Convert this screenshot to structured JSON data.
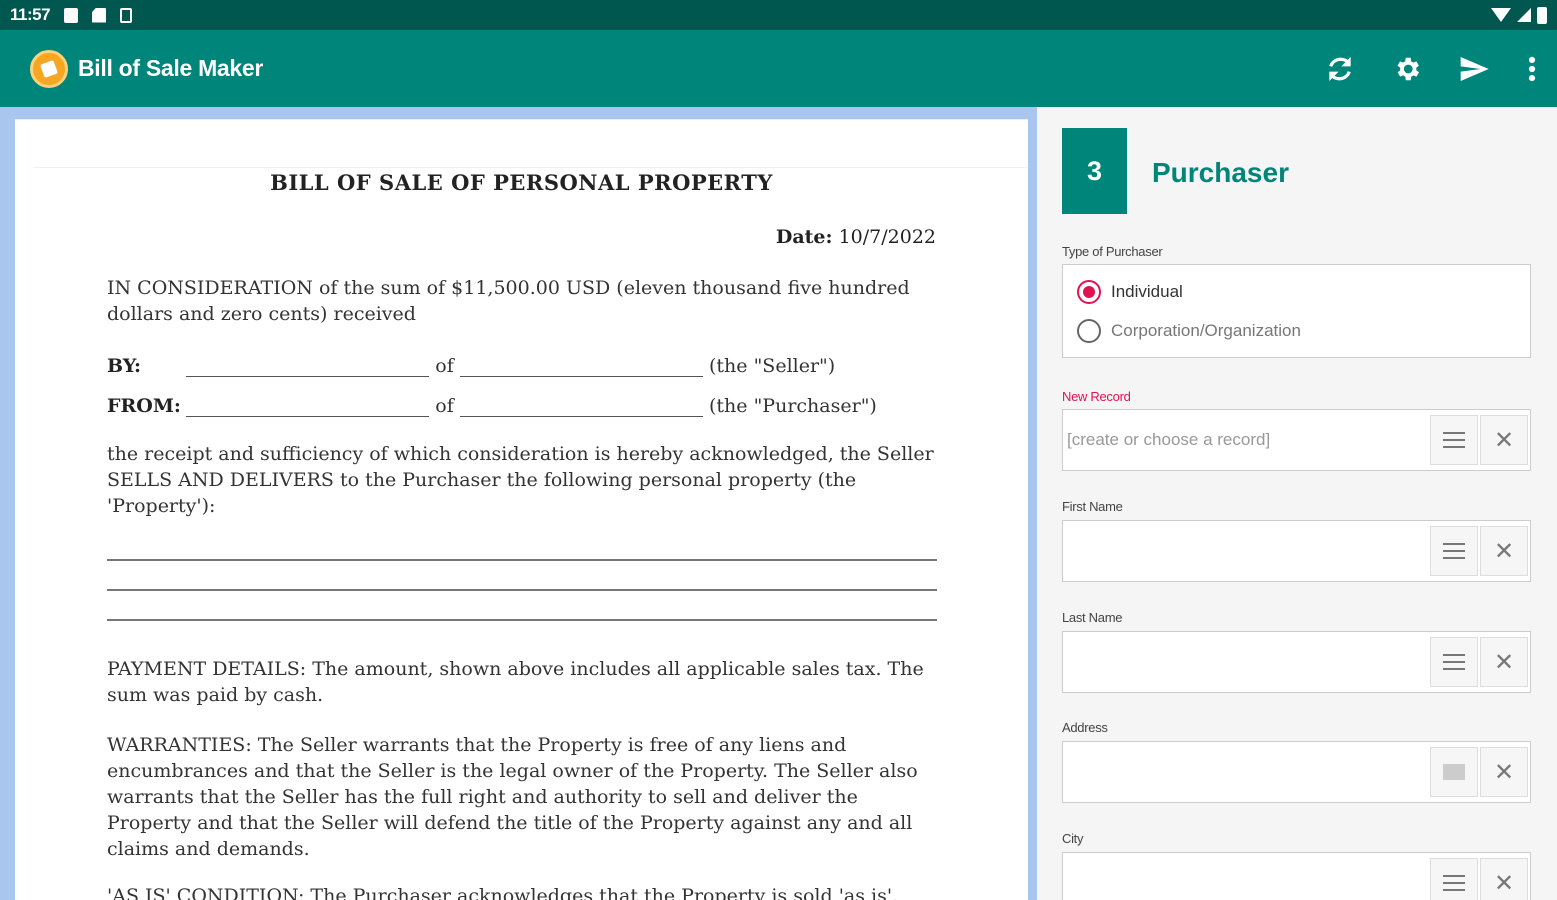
{
  "status_bar": {
    "time": "11:57"
  },
  "app": {
    "title": "Bill of Sale Maker"
  },
  "toolbar": {
    "refresh_icon": "refresh-icon",
    "settings_icon": "gear-icon",
    "send_icon": "send-icon",
    "more_icon": "more-vert-icon"
  },
  "document": {
    "title": "BILL OF SALE OF PERSONAL PROPERTY",
    "date_label": "Date:",
    "date_value": "10/7/2022",
    "consideration": "IN CONSIDERATION of the sum of $11,500.00 USD (eleven thousand five hundred dollars and zero cents) received",
    "by_label": "BY:",
    "from_label": "FROM:",
    "of": "of",
    "seller_role": "(the \"Seller\")",
    "purchaser_role": "(the \"Purchaser\")",
    "receipt_text": "the receipt and sufficiency of which consideration is hereby acknowledged, the Seller SELLS AND DELIVERS to the Purchaser the following personal property (the 'Property'):",
    "payment_details": "PAYMENT DETAILS: The amount, shown above includes all applicable sales tax. The sum was paid by cash.",
    "warranties": "WARRANTIES: The Seller warrants that the Property is free of any liens and encumbrances and that the Seller is the legal owner of the Property. The Seller also warrants that the Seller has the full right and authority to sell and deliver the Property and that the Seller will defend the title of the Property against any and all claims and demands.",
    "as_is": "'AS IS' CONDITION: The Purchaser acknowledges that the Property is sold 'as is'. The"
  },
  "form": {
    "step_number": "3",
    "step_title": "Purchaser",
    "type_label": "Type of Purchaser",
    "type_options": [
      "Individual",
      "Corporation/Organization"
    ],
    "selected_type": "Individual",
    "new_record_label": "New Record",
    "new_record_placeholder": "[create or choose a record]",
    "first_name_label": "First Name",
    "last_name_label": "Last Name",
    "address_label": "Address",
    "city_label": "City",
    "first_name_value": "",
    "last_name_value": "",
    "address_value": "",
    "city_value": ""
  },
  "colors": {
    "primary": "#00857a",
    "status_bar": "#00574f",
    "accent": "#e0134f",
    "doc_bg": "#a9c6ef"
  }
}
